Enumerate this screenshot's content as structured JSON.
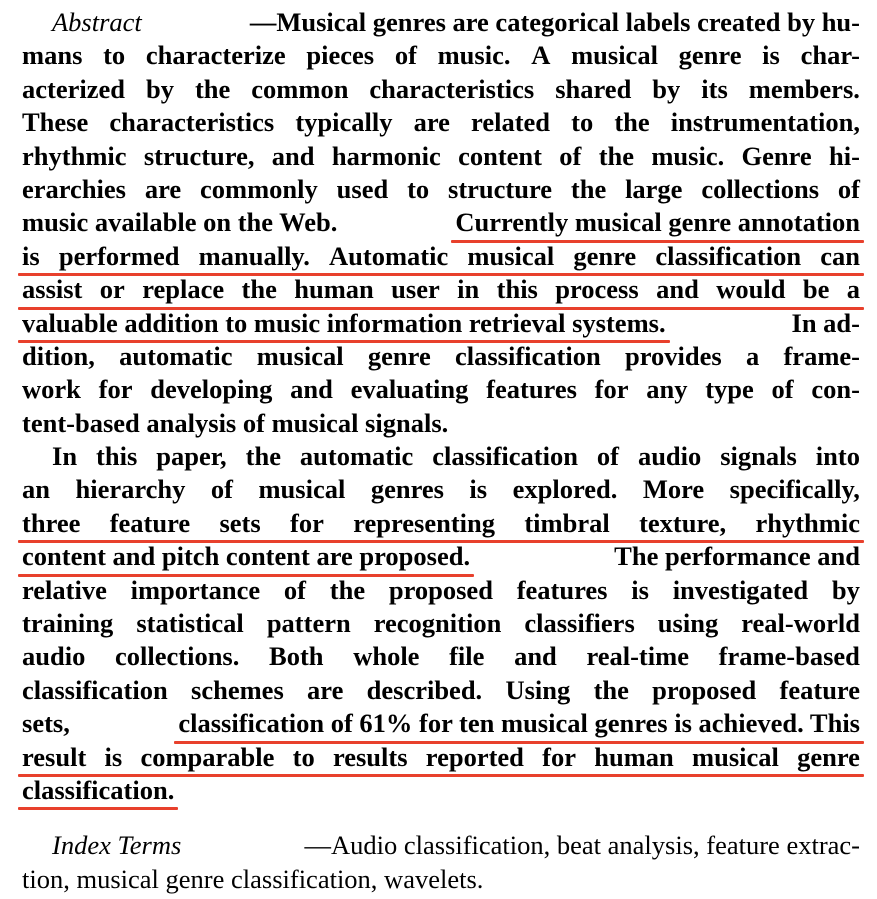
{
  "abstract": {
    "label": "Abstract",
    "lines": [
      "—Musical genres are categorical labels created by hu-",
      "mans to characterize pieces of music. A musical genre is char-",
      "acterized by the common characteristics shared by its members.",
      "These characteristics typically are related to the instrumentation,",
      "rhythmic structure, and harmonic content of the music. Genre hi-",
      "erarchies are commonly used to structure the large collections of",
      "music available on the Web.",
      "Currently musical genre annotation",
      "is performed manually. Automatic musical genre classification can",
      "assist or replace the human user in this process and would be a",
      "valuable addition to music information retrieval systems.",
      "In ad-",
      "dition, automatic musical genre classification provides a frame-",
      "work for developing and evaluating features for any type of con-",
      "tent-based analysis of musical signals."
    ]
  },
  "paragraph2": {
    "lines": [
      "In this paper, the automatic classification of audio signals into",
      "an hierarchy of musical genres is explored. More specifically,",
      "three feature sets for representing timbral texture, rhythmic",
      "content and pitch content are proposed.",
      "The performance and",
      "relative importance of the proposed features is investigated by",
      "training statistical pattern recognition classifiers using real-world",
      "audio collections. Both whole file and real-time frame-based",
      "classification schemes are described. Using the proposed feature",
      "sets,",
      "classification of 61% for ten musical genres is achieved. This",
      "result is comparable to results reported for human musical genre",
      "classification."
    ]
  },
  "index_terms": {
    "label": "Index Terms",
    "lines": [
      "—Audio classification, beat analysis, feature extrac-",
      "tion, musical genre classification, wavelets."
    ]
  }
}
